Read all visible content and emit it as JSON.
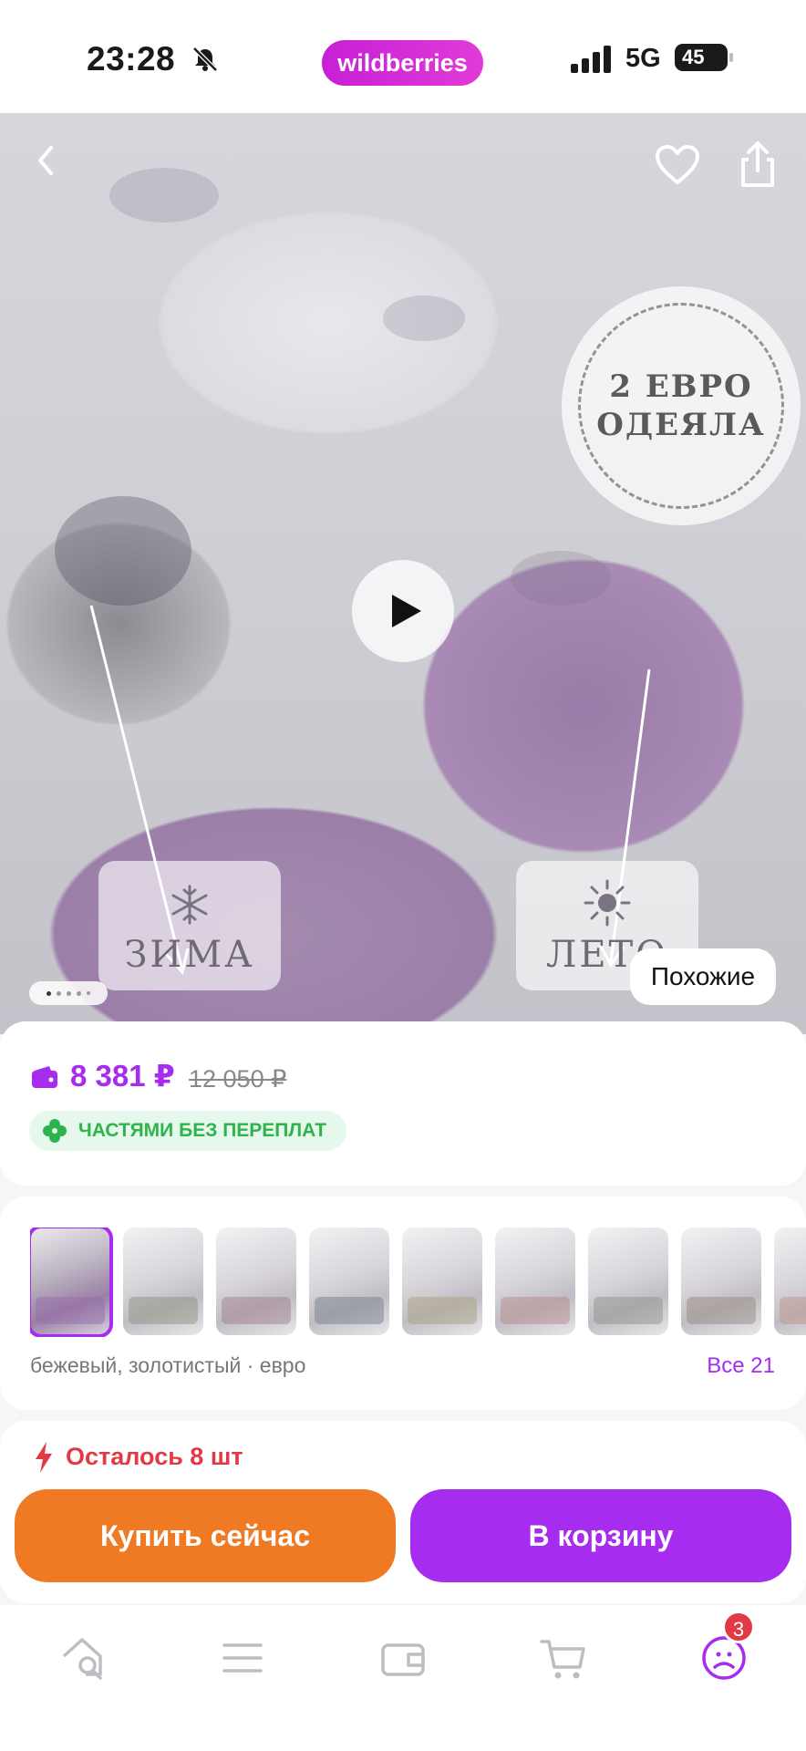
{
  "status_bar": {
    "time": "23:28",
    "network": "5G",
    "battery": "45"
  },
  "brand": {
    "name": "wildberries",
    "color": "#c71fd6"
  },
  "hero": {
    "badge_line1": "2 ЕВРО",
    "badge_line2": "ОДЕЯЛА",
    "label_winter": "ЗИМА",
    "label_summer": "ЛЕТО",
    "similar_button": "Похожие",
    "carousel_pages": 5,
    "carousel_current": 1,
    "icons": [
      "back-icon",
      "heart-icon",
      "share-icon",
      "play-icon",
      "snowflake-icon",
      "sun-icon"
    ]
  },
  "price": {
    "current": "8 381 ₽",
    "old": "12 050 ₽",
    "accent": "#a62cf0"
  },
  "installment": {
    "label": "ЧАСТЯМИ БЕЗ ПЕРЕПЛАТ",
    "color": "#2fb34d"
  },
  "variants": {
    "caption": "бежевый, золотистый · евро",
    "all_label": "Все 21",
    "thumb_count": 9
  },
  "stock": {
    "label": "Осталось 8 шт",
    "color": "#e23a45"
  },
  "actions": {
    "buy_now": "Купить сейчас",
    "add_to_cart": "В корзину",
    "buy_color": "#f07a24",
    "cart_color": "#a62cf0"
  },
  "tabbar": {
    "items": [
      "home-search-icon",
      "catalog-icon",
      "wallet-icon",
      "cart-icon",
      "profile-icon"
    ],
    "profile_badge": "3"
  }
}
